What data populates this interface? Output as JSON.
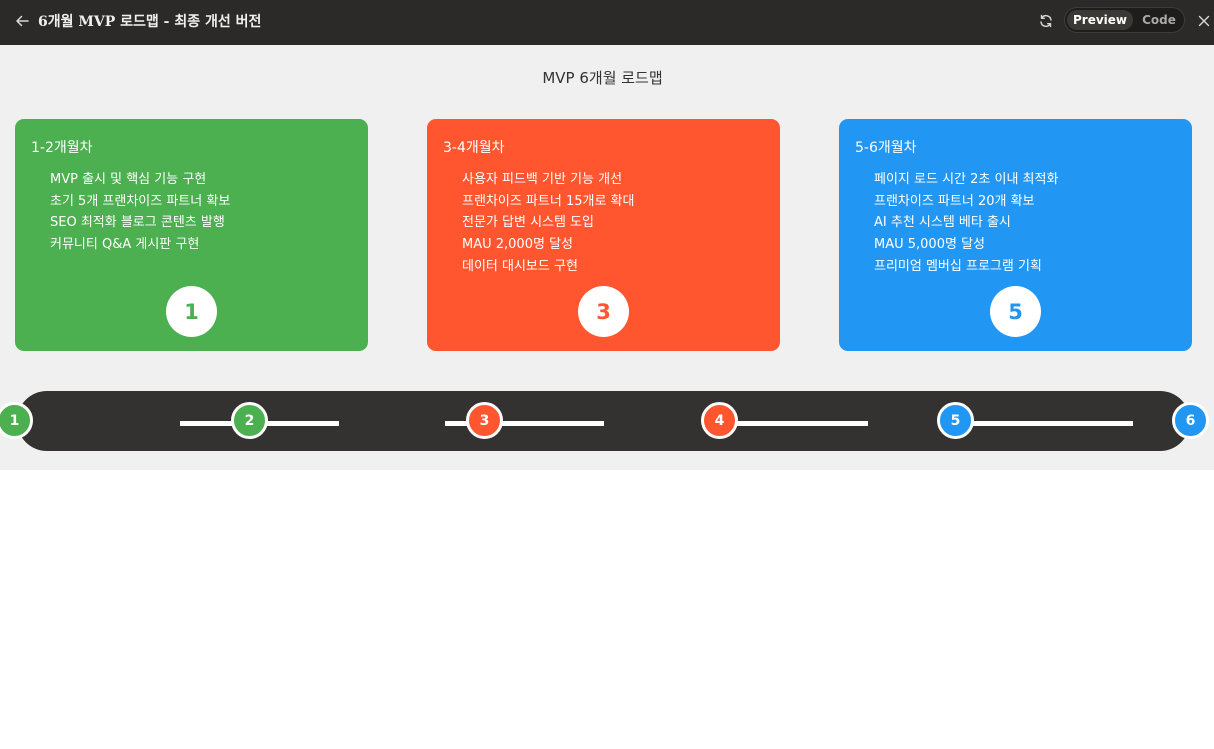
{
  "app": {
    "title": "6개월 MVP 로드맵 - 최종 개선 버전",
    "tabs": {
      "preview": "Preview",
      "code": "Code"
    },
    "icons": {
      "back": "arrow-left-icon",
      "refresh": "refresh-icon",
      "close": "close-icon"
    }
  },
  "page": {
    "title": "MVP 6개월 로드맵"
  },
  "cards": [
    {
      "title": "1-2개월차",
      "items": [
        "MVP 출시 및 핵심 기능 구현",
        "초기 5개 프랜차이즈 파트너 확보",
        "SEO 최적화 블로그 콘텐츠 발행",
        "커뮤니티 Q&A 게시판 구현"
      ],
      "badge": "1",
      "color": "#4caf50"
    },
    {
      "title": "3-4개월차",
      "items": [
        "사용자 피드백 기반 기능 개선",
        "프랜차이즈 파트너 15개로 확대",
        "전문가 답변 시스템 도입",
        "MAU 2,000명 달성",
        "데이터 대시보드 구현"
      ],
      "badge": "3",
      "color": "#ff5630"
    },
    {
      "title": "5-6개월차",
      "items": [
        "페이지 로드 시간 2초 이내 최적화",
        "프랜차이즈 파트너 20개 확보",
        "AI 추천 시스템 베타 출시",
        "MAU 5,000명 달성",
        "프리미엄 멤버십 프로그램 기획"
      ],
      "badge": "5",
      "color": "#2196f3"
    }
  ],
  "timeline": {
    "months": [
      "1",
      "2",
      "3",
      "4",
      "5",
      "6"
    ]
  }
}
